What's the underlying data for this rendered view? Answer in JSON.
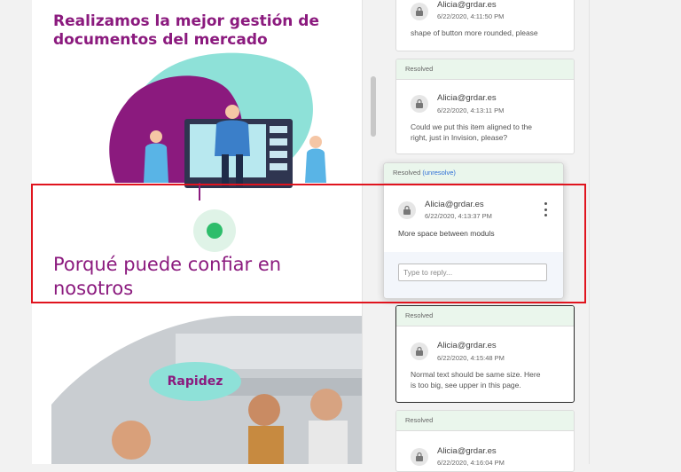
{
  "document": {
    "heading_line1": "Realizamos la mejor gestión de",
    "heading_line2": "documentos del mercado",
    "title_line1": "Porqué puede confiar en",
    "title_line2": "nosotros",
    "badge": "Rapidez"
  },
  "comments": [
    {
      "author": "Alicia@grdar.es",
      "time": "6/22/2020, 4:11:50 PM",
      "text": "shape of button more rounded, please"
    },
    {
      "status": "Resolved",
      "author": "Alicia@grdar.es",
      "time": "6/22/2020, 4:13:11 PM",
      "text_line1": "Could we put this item aligned to the",
      "text_line2": "right, just in Invision, please?"
    },
    {
      "status": "Resolved",
      "action": "(unresolve)",
      "author": "Alicia@grdar.es",
      "time": "6/22/2020, 4:13:37 PM",
      "text": "More space between moduls",
      "reply_placeholder": "Type to reply..."
    },
    {
      "status": "Resolved",
      "author": "Alicia@grdar.es",
      "time": "6/22/2020, 4:15:48 PM",
      "text_line1": "Normal text should be same size. Here",
      "text_line2": "is too big, see upper in this page."
    },
    {
      "status": "Resolved",
      "author": "Alicia@grdar.es",
      "time": "6/22/2020, 4:16:04 PM"
    }
  ],
  "colors": {
    "brand": "#8b1a7e",
    "accent": "#8ee1d8",
    "highlight": "#e0141e",
    "resolved_bg": "#eaf6ec",
    "marker": "#2ebd6b"
  },
  "icons": {
    "avatar": "user-lock-icon",
    "menu": "vertical-dots-icon",
    "marker": "comment-marker-icon"
  }
}
